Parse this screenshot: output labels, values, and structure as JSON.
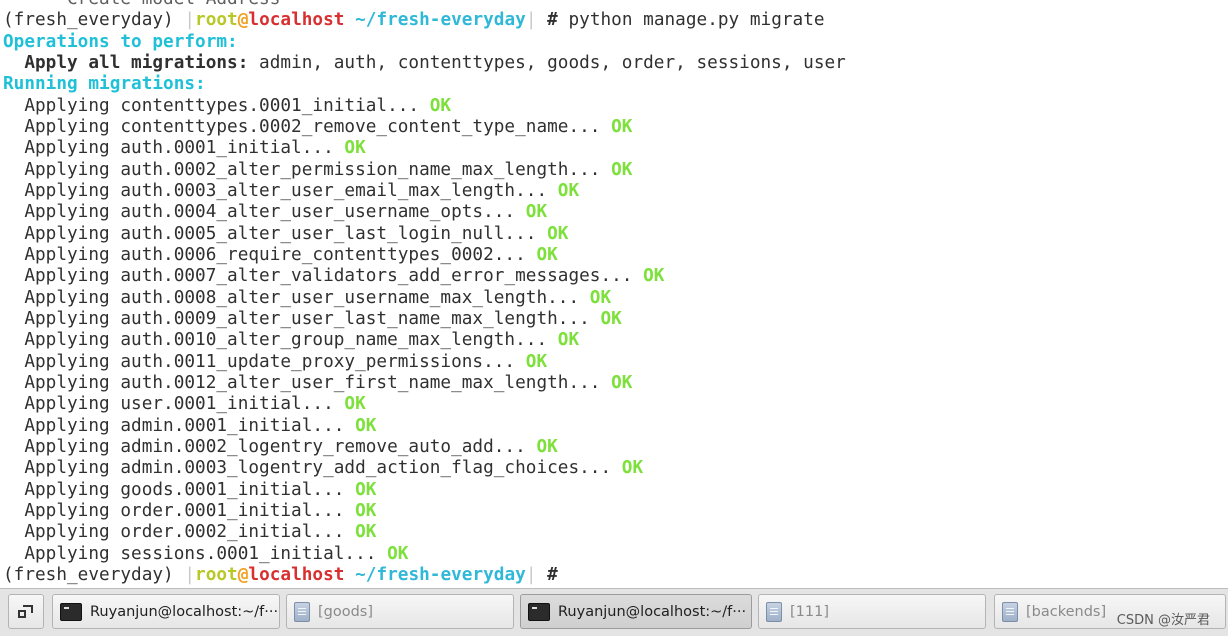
{
  "terminal": {
    "lines": [
      {
        "kind": "text",
        "text": "    - Create model Address"
      },
      {
        "kind": "prompt",
        "env": "(fresh_everyday)",
        "user": "root",
        "at": "@",
        "host": "localhost",
        "cwd": "~/fresh-everyday",
        "symbol": "#",
        "command": " python manage.py migrate"
      },
      {
        "kind": "header",
        "text": "Operations to perform:"
      },
      {
        "kind": "apply_all",
        "label": "  Apply all migrations:",
        "apps": " admin, auth, contenttypes, goods, order, sessions, user"
      },
      {
        "kind": "header",
        "text": "Running migrations:"
      },
      {
        "kind": "migration",
        "text": "  Applying contenttypes.0001_initial...",
        "status": "OK"
      },
      {
        "kind": "migration",
        "text": "  Applying contenttypes.0002_remove_content_type_name...",
        "status": "OK"
      },
      {
        "kind": "migration",
        "text": "  Applying auth.0001_initial...",
        "status": "OK"
      },
      {
        "kind": "migration",
        "text": "  Applying auth.0002_alter_permission_name_max_length...",
        "status": "OK"
      },
      {
        "kind": "migration",
        "text": "  Applying auth.0003_alter_user_email_max_length...",
        "status": "OK"
      },
      {
        "kind": "migration",
        "text": "  Applying auth.0004_alter_user_username_opts...",
        "status": "OK"
      },
      {
        "kind": "migration",
        "text": "  Applying auth.0005_alter_user_last_login_null...",
        "status": "OK"
      },
      {
        "kind": "migration",
        "text": "  Applying auth.0006_require_contenttypes_0002...",
        "status": "OK"
      },
      {
        "kind": "migration",
        "text": "  Applying auth.0007_alter_validators_add_error_messages...",
        "status": "OK"
      },
      {
        "kind": "migration",
        "text": "  Applying auth.0008_alter_user_username_max_length...",
        "status": "OK"
      },
      {
        "kind": "migration",
        "text": "  Applying auth.0009_alter_user_last_name_max_length...",
        "status": "OK"
      },
      {
        "kind": "migration",
        "text": "  Applying auth.0010_alter_group_name_max_length...",
        "status": "OK"
      },
      {
        "kind": "migration",
        "text": "  Applying auth.0011_update_proxy_permissions...",
        "status": "OK"
      },
      {
        "kind": "migration",
        "text": "  Applying auth.0012_alter_user_first_name_max_length...",
        "status": "OK"
      },
      {
        "kind": "migration",
        "text": "  Applying user.0001_initial...",
        "status": "OK"
      },
      {
        "kind": "migration",
        "text": "  Applying admin.0001_initial...",
        "status": "OK"
      },
      {
        "kind": "migration",
        "text": "  Applying admin.0002_logentry_remove_auto_add...",
        "status": "OK"
      },
      {
        "kind": "migration",
        "text": "  Applying admin.0003_logentry_add_action_flag_choices...",
        "status": "OK"
      },
      {
        "kind": "migration",
        "text": "  Applying goods.0001_initial...",
        "status": "OK"
      },
      {
        "kind": "migration",
        "text": "  Applying order.0001_initial...",
        "status": "OK"
      },
      {
        "kind": "migration",
        "text": "  Applying order.0002_initial...",
        "status": "OK"
      },
      {
        "kind": "migration",
        "text": "  Applying sessions.0001_initial...",
        "status": "OK"
      },
      {
        "kind": "prompt",
        "env": "(fresh_everyday)",
        "user": "root",
        "at": "@",
        "host": "localhost",
        "cwd": "~/fresh-everyday",
        "symbol": "#",
        "command": ""
      }
    ]
  },
  "taskbar": {
    "show_desktop_icon": "show-desktop-icon",
    "items": [
      {
        "label": "Ruyanjun@localhost:~/f···",
        "icon": "terminal-icon",
        "state": "normal"
      },
      {
        "label": "[goods]",
        "icon": "document-icon",
        "state": "minimized"
      },
      {
        "label": "Ruyanjun@localhost:~/f···",
        "icon": "terminal-icon",
        "state": "active"
      },
      {
        "label": "[111]",
        "icon": "document-icon",
        "state": "minimized"
      },
      {
        "label": "[backends]",
        "icon": "document-icon",
        "state": "minimized"
      }
    ]
  },
  "watermark": "CSDN @汝严君"
}
